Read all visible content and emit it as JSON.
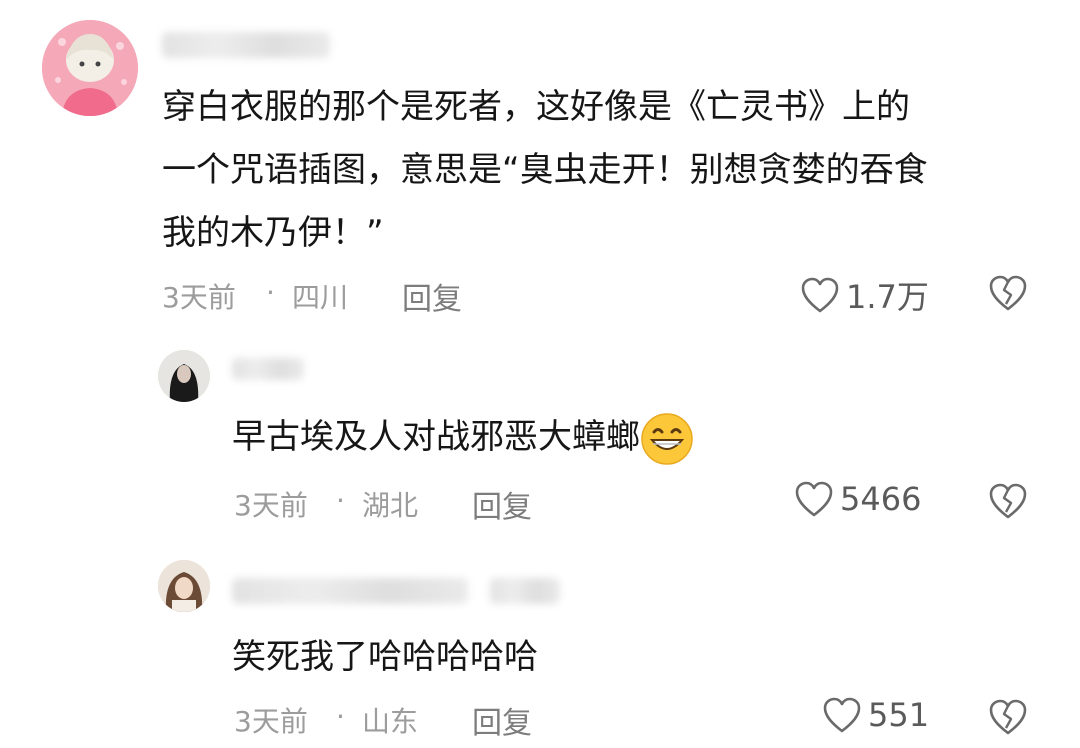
{
  "comments": [
    {
      "text_lines": [
        "穿白衣服的那个是死者，这好像是《亡灵书》上的",
        "一个咒语插图，意思是“臭虫走开！别想贪婪的吞食",
        "我的木乃伊！”"
      ],
      "time": "3天前",
      "separator": "·",
      "location": "四川",
      "reply_label": "回复",
      "likes": "1.7万"
    },
    {
      "text": "早古埃及人对战邪恶大蟑螂",
      "emoji": "grinning-emoji",
      "time": "3天前",
      "separator": "·",
      "location": "湖北",
      "reply_label": "回复",
      "likes": "5466"
    },
    {
      "text": "笑死我了哈哈哈哈哈",
      "time": "3天前",
      "separator": "·",
      "location": "山东",
      "reply_label": "回复",
      "likes": "551"
    }
  ],
  "icons": {
    "like": "heart-outline-icon",
    "dislike": "broken-heart-icon"
  },
  "colors": {
    "text": "#161616",
    "meta": "#9c9c9c",
    "avatar_bg": "#f2a1b3"
  }
}
